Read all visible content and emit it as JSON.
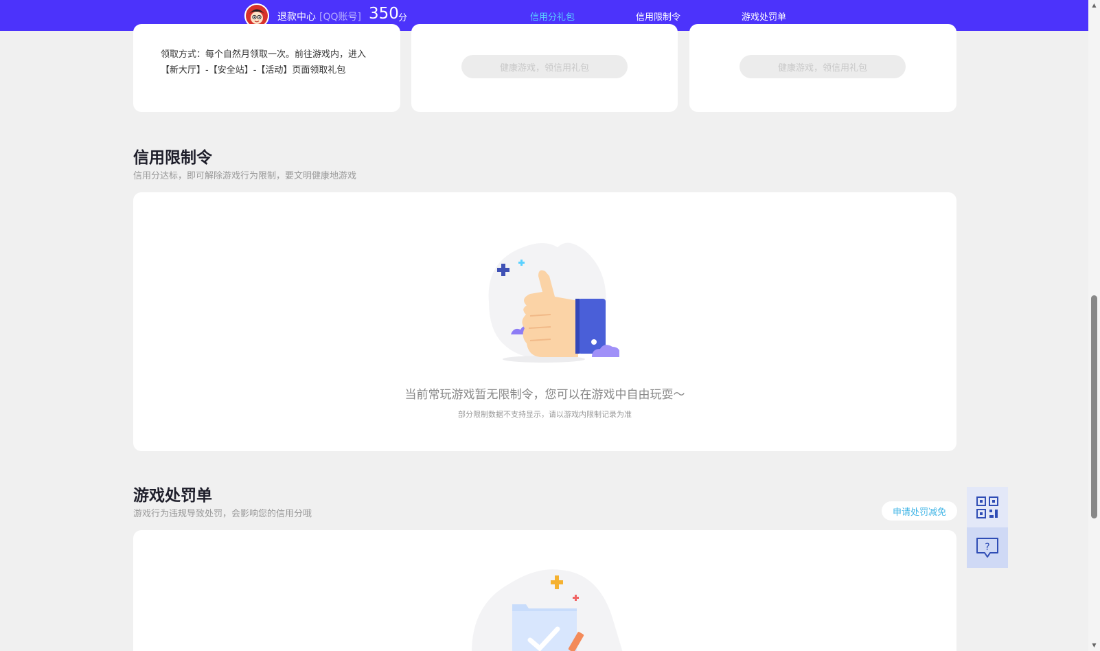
{
  "header": {
    "title": "退款中心",
    "account_type": "[QQ账号]",
    "score": "350",
    "score_unit": "分",
    "nav": [
      {
        "label": "信用分礼包",
        "active": true
      },
      {
        "label": "信用限制令",
        "active": false
      },
      {
        "label": "游戏处罚单",
        "active": false
      }
    ]
  },
  "gift_cards": {
    "claim_text": "领取方式：每个自然月领取一次。前往游戏内，进入【新大厅】-【安全站】-【活动】页面领取礼包",
    "disabled_button": "健康游戏，领信用礼包",
    "disabled_button_2": "健康游戏，领信用礼包"
  },
  "restriction": {
    "title": "信用限制令",
    "subtitle": "信用分达标，即可解除游戏行为限制，要文明健康地游戏",
    "empty_main": "当前常玩游戏暂无限制令，您可以在游戏中自由玩耍～",
    "empty_sub": "部分限制数据不支持显示，请以游戏内限制记录为准"
  },
  "penalty": {
    "title": "游戏处罚单",
    "subtitle": "游戏行为违规导致处罚，会影响您的信用分哦",
    "appeal_button": "申请处罚减免"
  },
  "colors": {
    "brand": "#4c33fb",
    "accent": "#5ad1ff",
    "link": "#3fb4e6"
  },
  "icons": {
    "qr": "qr-code-icon",
    "help": "help-chat-icon"
  }
}
